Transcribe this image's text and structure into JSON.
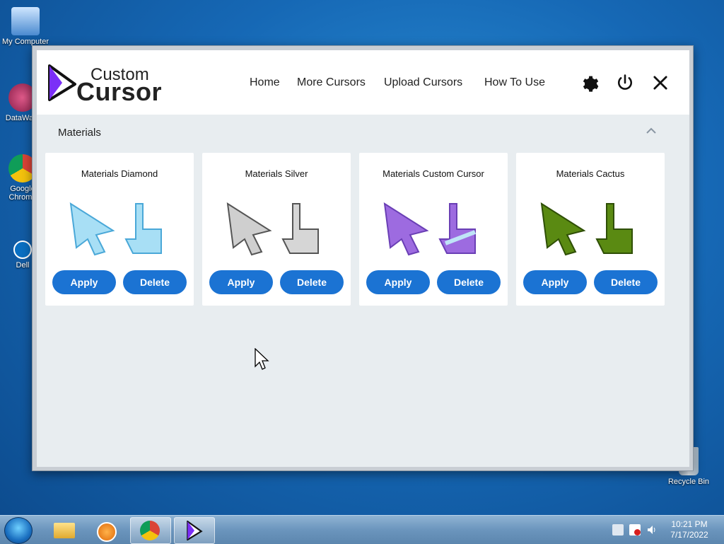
{
  "desktop": {
    "icons": [
      {
        "label": "My Computer"
      },
      {
        "label": "DataWa..."
      },
      {
        "label": "Google Chrome"
      },
      {
        "label": "Dell"
      },
      {
        "label": "Recycle Bin"
      }
    ]
  },
  "app": {
    "logo": {
      "line1": "Custom",
      "line2": "Cursor"
    },
    "nav": [
      "Home",
      "More Cursors",
      "Upload Cursors",
      "How To Use"
    ],
    "icons": [
      "gear-icon",
      "power-icon",
      "close-icon"
    ],
    "section_title": "Materials",
    "cards": [
      {
        "title": "Materials Diamond",
        "color": "#a8dff5",
        "apply": "Apply",
        "delete": "Delete"
      },
      {
        "title": "Materials Silver",
        "color": "#cfcfcf",
        "apply": "Apply",
        "delete": "Delete"
      },
      {
        "title": "Materials Custom Cursor",
        "color": "#9d6be0",
        "apply": "Apply",
        "delete": "Delete"
      },
      {
        "title": "Materials Cactus",
        "color": "#5a8a12",
        "apply": "Apply",
        "delete": "Delete"
      }
    ],
    "accent": "#1b73d3"
  },
  "taskbar": {
    "clock_time": "10:21 PM",
    "clock_date": "7/17/2022"
  }
}
